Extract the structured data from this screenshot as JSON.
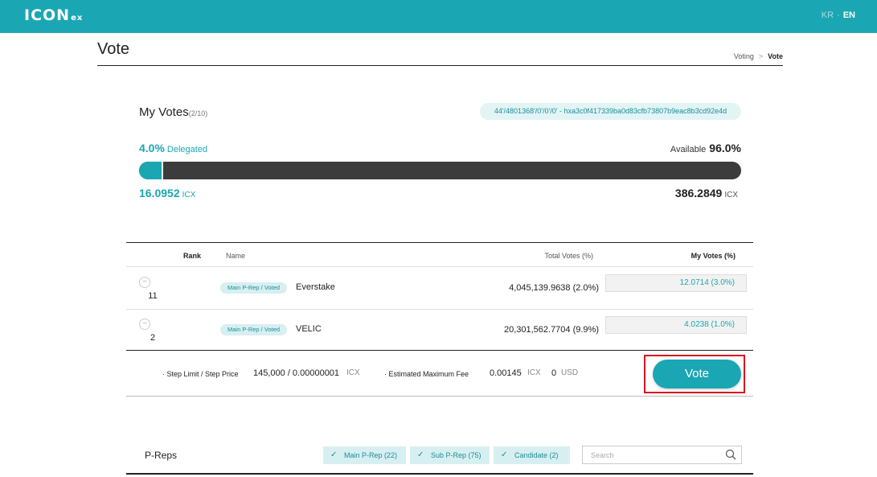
{
  "header": {
    "logo_main": "ICON",
    "logo_sub": "ex",
    "lang_kr": "KR",
    "lang_sep": "·",
    "lang_en": "EN"
  },
  "page": {
    "title": "Vote",
    "breadcrumb": [
      "Voting",
      "Vote"
    ],
    "breadcrumb_sep": ">"
  },
  "my_votes": {
    "title": "My Votes",
    "count": "(2/10)",
    "address": "44'/4801368'/0'/0'/0' - hxa3c0f417339ba0d83cfb73807b9eac8b3cd92e4d",
    "delegated_pct": "4.0%",
    "delegated_label": "Delegated",
    "available_label": "Available",
    "available_pct": "96.0%",
    "delegated_amount": "16.0952",
    "available_amount": "386.2849",
    "unit": "ICX",
    "delegated_fraction": 0.04
  },
  "table": {
    "headers": {
      "rank": "Rank",
      "name": "Name",
      "total_votes": "Total Votes (%)",
      "my_votes": "My Votes (%)"
    },
    "rows": [
      {
        "rank": "11",
        "badge": "Main P-Rep / Voted",
        "name": "Everstake",
        "total_votes": "4,045,139.9638 (2.0%)",
        "my_votes": "12.0714 (3.0%)"
      },
      {
        "rank": "2",
        "badge": "Main P-Rep / Voted",
        "name": "VELIC",
        "total_votes": "20,301,562.7704 (9.9%)",
        "my_votes": "4.0238 (1.0%)"
      }
    ],
    "remove_symbol": "−"
  },
  "fees": {
    "step_label": "· Step Limit / Step Price",
    "step_value": "145,000 / 0.00000001",
    "step_unit": "ICX",
    "est_label": "· Estimated Maximum Fee",
    "est_value": "0.00145",
    "est_unit": "ICX",
    "usd_value": "0",
    "usd_unit": "USD"
  },
  "vote_button": "Vote",
  "preps": {
    "title": "P-Reps",
    "filters": [
      "Main P-Rep (22)",
      "Sub P-Rep (75)",
      "Candidate (2)"
    ],
    "check": "✓",
    "search_placeholder": "Search"
  },
  "colors": {
    "accent": "#1aa7b3",
    "highlight": "#d9141e"
  }
}
